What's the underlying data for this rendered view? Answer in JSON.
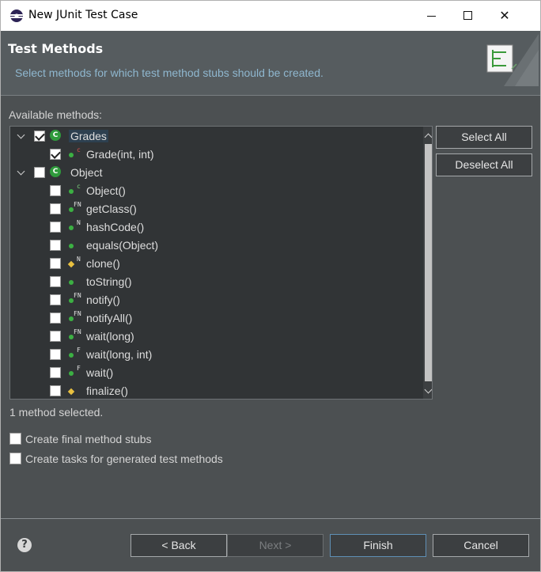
{
  "window": {
    "title": "New JUnit Test Case",
    "controls": {
      "minimize": "minimize-icon",
      "maximize": "maximize-icon",
      "close": "✕"
    }
  },
  "banner": {
    "title": "Test Methods",
    "description": "Select methods for which test method stubs should be created."
  },
  "methods_panel": {
    "label": "Available methods:",
    "tree": [
      {
        "label": "Grades",
        "kind": "class",
        "expanded": true,
        "checked": true,
        "selected": true,
        "children": [
          {
            "label": "Grade(int, int)",
            "checked": true,
            "icon": "public-method-constructor-icon"
          }
        ]
      },
      {
        "label": "Object",
        "kind": "class",
        "expanded": true,
        "checked": false,
        "children": [
          {
            "label": "Object()",
            "checked": false,
            "icon": "public-method-constructor-icon"
          },
          {
            "label": "getClass()",
            "checked": false,
            "icon": "public-final-native-method-icon"
          },
          {
            "label": "hashCode()",
            "checked": false,
            "icon": "public-native-method-icon"
          },
          {
            "label": "equals(Object)",
            "checked": false,
            "icon": "public-method-icon"
          },
          {
            "label": "clone()",
            "checked": false,
            "icon": "protected-native-method-icon"
          },
          {
            "label": "toString()",
            "checked": false,
            "icon": "public-method-icon"
          },
          {
            "label": "notify()",
            "checked": false,
            "icon": "public-final-native-method-icon"
          },
          {
            "label": "notifyAll()",
            "checked": false,
            "icon": "public-final-native-method-icon"
          },
          {
            "label": "wait(long)",
            "checked": false,
            "icon": "public-final-native-method-icon"
          },
          {
            "label": "wait(long, int)",
            "checked": false,
            "icon": "public-final-method-icon"
          },
          {
            "label": "wait()",
            "checked": false,
            "icon": "public-final-method-icon"
          },
          {
            "label": "finalize()",
            "checked": false,
            "icon": "protected-method-icon"
          }
        ]
      }
    ],
    "status": "1 method selected.",
    "select_all": "Select All",
    "deselect_all": "Deselect All"
  },
  "options": {
    "final_stubs": {
      "label": "Create final method stubs",
      "checked": false
    },
    "tasks": {
      "label": "Create tasks for generated test methods",
      "checked": false
    }
  },
  "footer": {
    "back": "< Back",
    "next": "Next >",
    "finish": "Finish",
    "cancel": "Cancel",
    "help": "?"
  },
  "colors": {
    "dialog_bg": "#4c5052",
    "banner_bg": "#565c5f",
    "tree_bg": "#313436",
    "description_text": "#8fb7cf",
    "class_icon": "#2f9b3c"
  }
}
